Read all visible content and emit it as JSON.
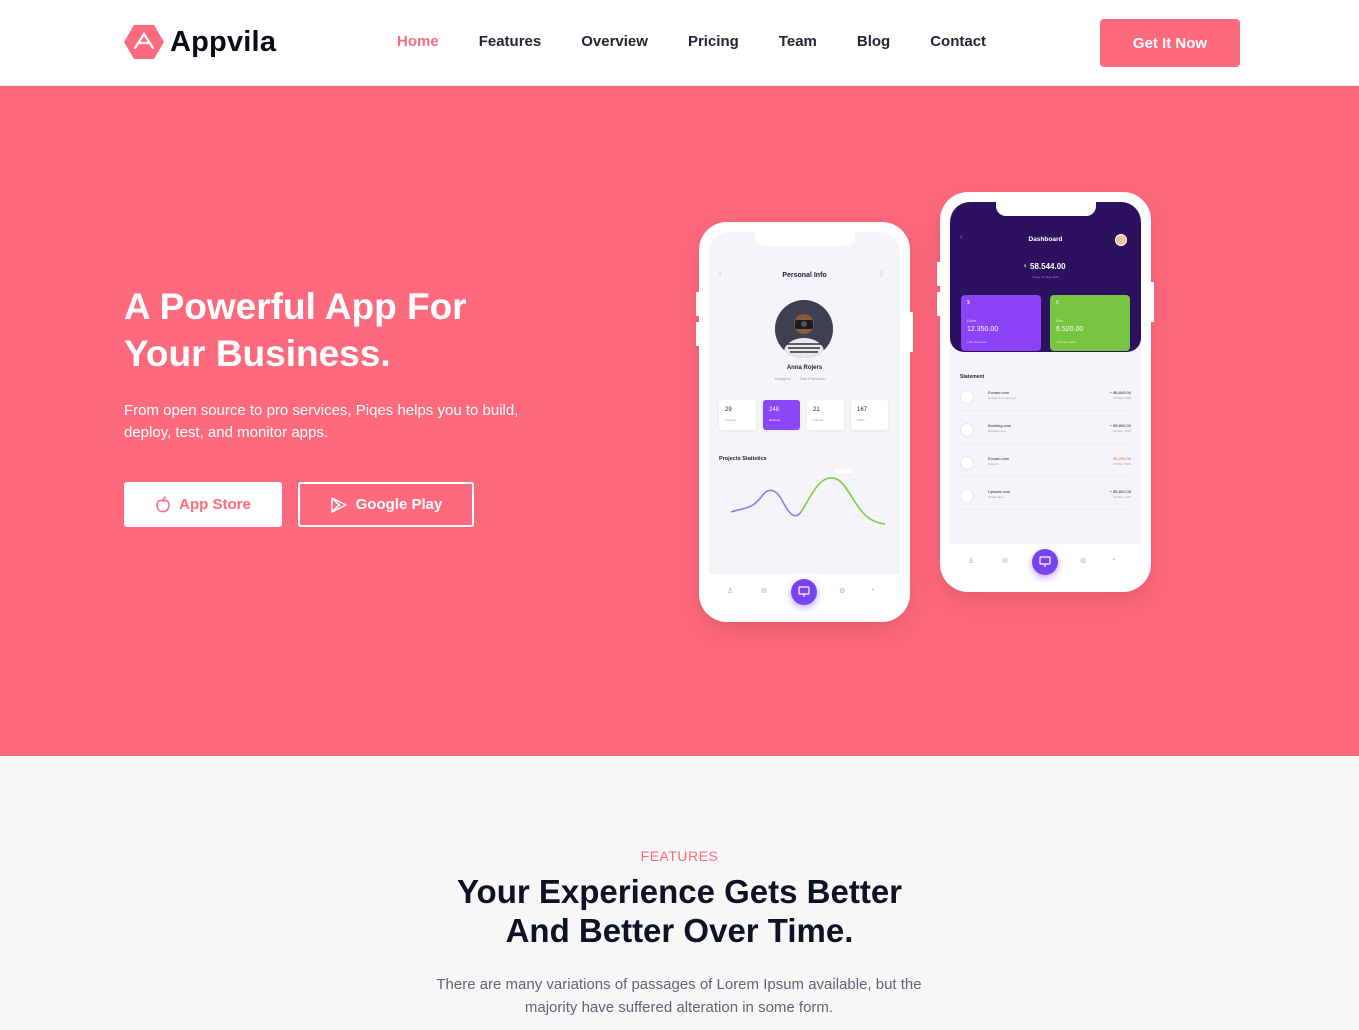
{
  "brand": {
    "name": "Appvila",
    "accent": "#fe6a7d"
  },
  "nav": {
    "items": [
      "Home",
      "Features",
      "Overview",
      "Pricing",
      "Team",
      "Blog",
      "Contact"
    ],
    "active": "Home",
    "cta": "Get It Now"
  },
  "hero": {
    "title_line1": "A Powerful App For",
    "title_line2": "Your Business.",
    "description": "From open source to pro services, Piqes helps you to build, deploy, test, and monitor apps.",
    "btn_appstore": "App Store",
    "btn_googleplay": "Google Play"
  },
  "phone_left": {
    "header": "Personal Info",
    "name": "Anna Rojers",
    "role": "Designer",
    "location": "San Francisco",
    "stats": [
      {
        "num": "29",
        "label": "Projects"
      },
      {
        "num": "248",
        "label": "Reviews"
      },
      {
        "num": "21",
        "label": "Friends"
      },
      {
        "num": "167",
        "label": "Tasks"
      }
    ],
    "chart_title": "Projects Statistics"
  },
  "phone_right": {
    "header": "Dashboard",
    "balance": "58.544.00",
    "balance_currency": "$",
    "date": "Today, 22 May 2019",
    "cards": [
      {
        "symbol": "$",
        "name": "Dollar",
        "value": "12.350.00",
        "note": "+5% last week"
      },
      {
        "symbol": "€",
        "name": "Euro",
        "value": "6.520.00",
        "note": "+5% last week"
      }
    ],
    "statement_title": "Statement",
    "statements": [
      {
        "name": "Envato.com",
        "sub": "Design Development",
        "amount": "+ $5,800.00",
        "date": "18 May, 2019"
      },
      {
        "name": "Booking.com",
        "sub": "Development",
        "amount": "+ €5,800.00",
        "date": "18 May, 2019"
      },
      {
        "name": "Envato.com",
        "sub": "Support",
        "amount": "- $3,200.00",
        "date": "18 May, 2019"
      },
      {
        "name": "Upwork.com",
        "sub": "Mobile Apps",
        "amount": "+ $5,800.00",
        "date": "18 May, 2019"
      }
    ]
  },
  "features": {
    "tag": "FEATURES",
    "title_line1": "Your Experience Gets Better",
    "title_line2": "And Better Over Time.",
    "description": "There are many variations of passages of Lorem Ipsum available, but the majority have suffered alteration in some form."
  }
}
